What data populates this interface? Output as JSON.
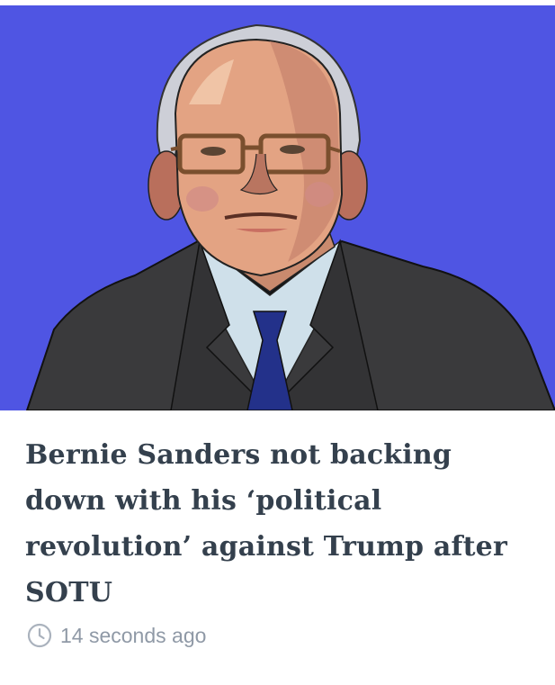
{
  "article": {
    "image_alt": "Illustration of Bernie Sanders",
    "headline": "Bernie Sanders not backing down with his ‘political revolution’ against Trump after SOTU",
    "timestamp": "14 seconds ago",
    "timestamp_icon": "clock-icon"
  },
  "colors": {
    "image_background": "#4f55e3",
    "headline": "#34404d",
    "timestamp": "#8f99a6"
  }
}
